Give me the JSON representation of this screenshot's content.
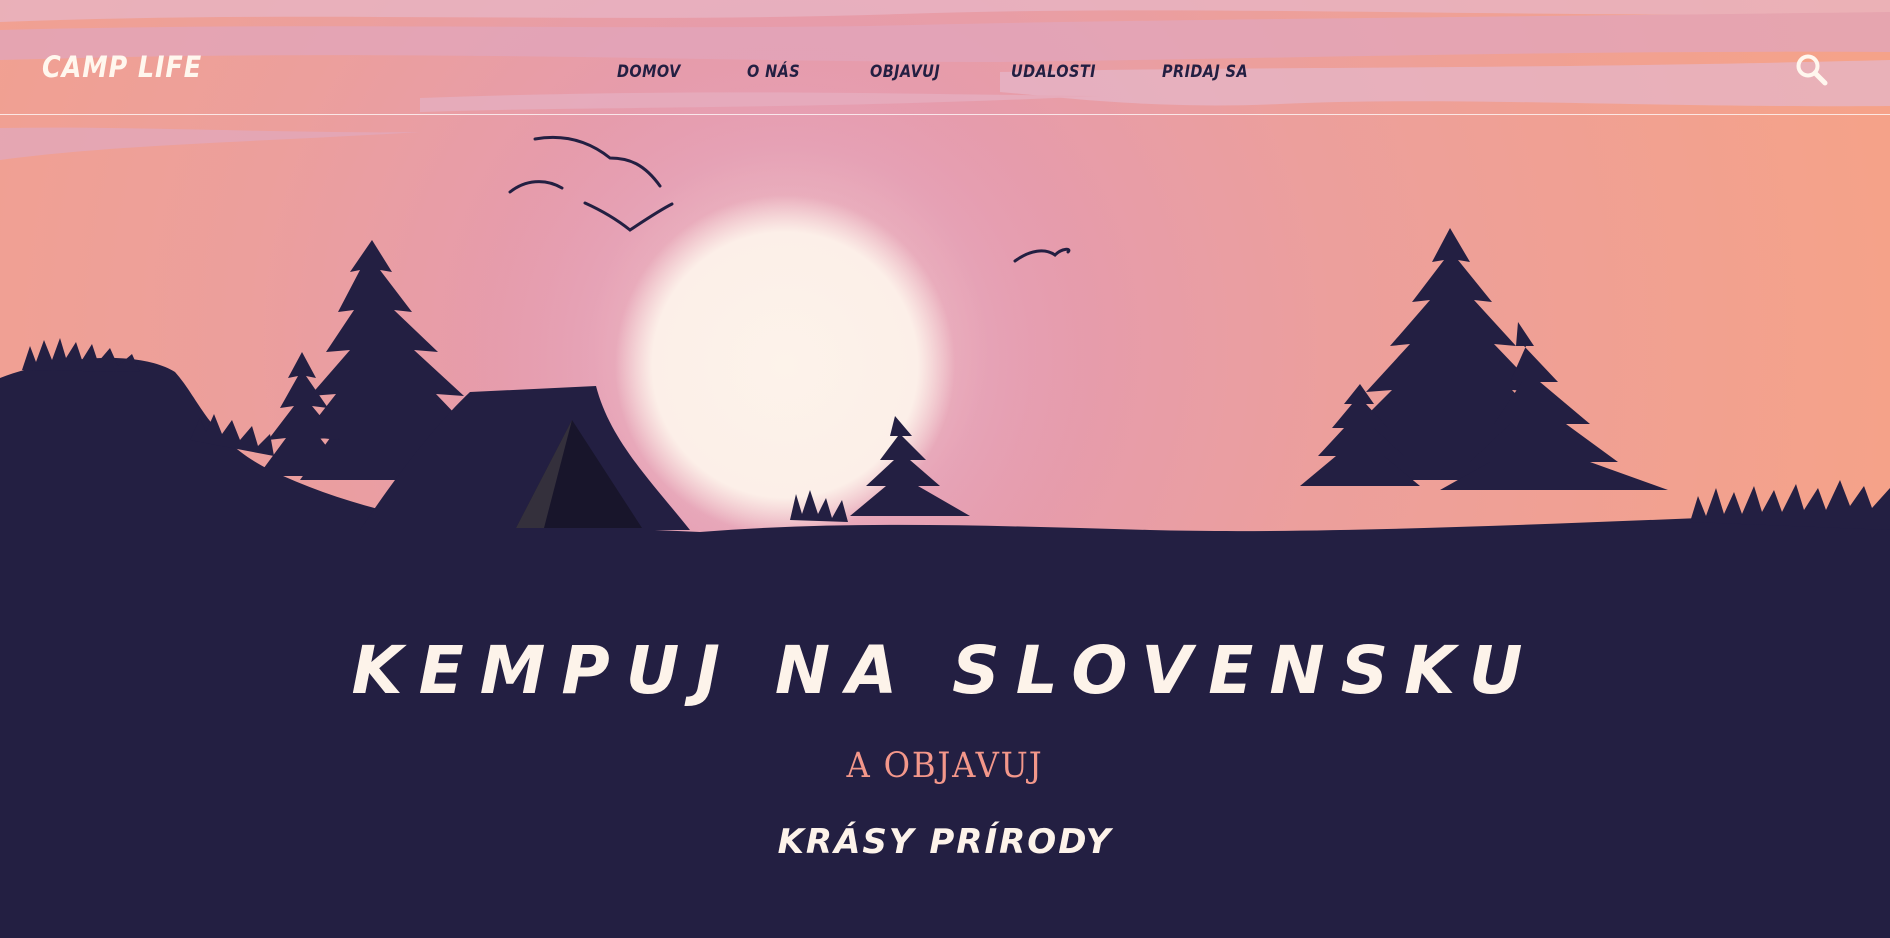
{
  "brand": {
    "logo": "CAMP LIFE"
  },
  "nav": {
    "items": [
      {
        "label": "DOMOV"
      },
      {
        "label": "O NÁS"
      },
      {
        "label": "OBJAVUJ"
      },
      {
        "label": "UDALOSTI"
      },
      {
        "label": "PRIDAJ SA"
      }
    ],
    "search_icon": "search-icon"
  },
  "hero": {
    "title": "KEMPUJ NA SLOVENSKU",
    "subtitle": "A OBJAVUJ",
    "tagline": "KRÁSY PRÍRODY"
  },
  "colors": {
    "night": "#231f42",
    "sky_warm": "#f4a08a",
    "sky_pink": "#e59aae",
    "sun": "#fdf3ea",
    "accent": "#f3978a"
  }
}
